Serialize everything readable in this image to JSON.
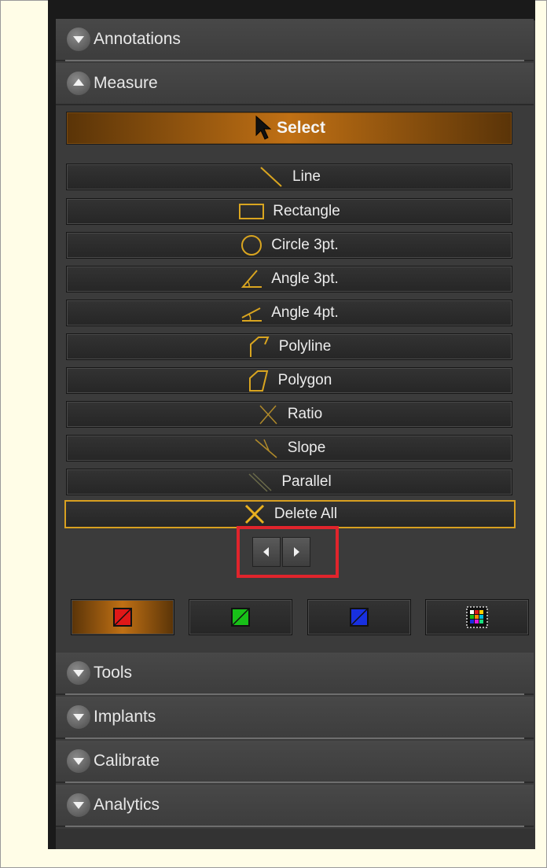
{
  "sections": {
    "annotations": "Annotations",
    "measure": "Measure",
    "tools": "Tools",
    "implants": "Implants",
    "calibrate": "Calibrate",
    "analytics": "Analytics"
  },
  "measure": {
    "select_label": "Select",
    "tools": [
      {
        "label": "Line",
        "icon": "line-icon"
      },
      {
        "label": "Rectangle",
        "icon": "rectangle-icon"
      },
      {
        "label": "Circle 3pt.",
        "icon": "circle-icon"
      },
      {
        "label": "Angle 3pt.",
        "icon": "angle-3pt-icon"
      },
      {
        "label": "Angle 4pt.",
        "icon": "angle-4pt-icon"
      },
      {
        "label": "Polyline",
        "icon": "polyline-icon"
      },
      {
        "label": "Polygon",
        "icon": "polygon-icon"
      },
      {
        "label": "Ratio",
        "icon": "ratio-icon"
      },
      {
        "label": "Slope",
        "icon": "slope-icon"
      },
      {
        "label": "Parallel",
        "icon": "parallel-icon"
      },
      {
        "label": "Delete All",
        "icon": "delete-x-icon"
      }
    ],
    "colors": [
      {
        "name": "red",
        "hex": "#e01818"
      },
      {
        "name": "green",
        "hex": "#18c018"
      },
      {
        "name": "blue",
        "hex": "#1830e0"
      },
      {
        "name": "multi-color",
        "hex": "#ffffff"
      }
    ]
  },
  "theme": {
    "accent": "#d08a1c",
    "highlight": "#e0242c",
    "icon_color": "#d9a520"
  }
}
